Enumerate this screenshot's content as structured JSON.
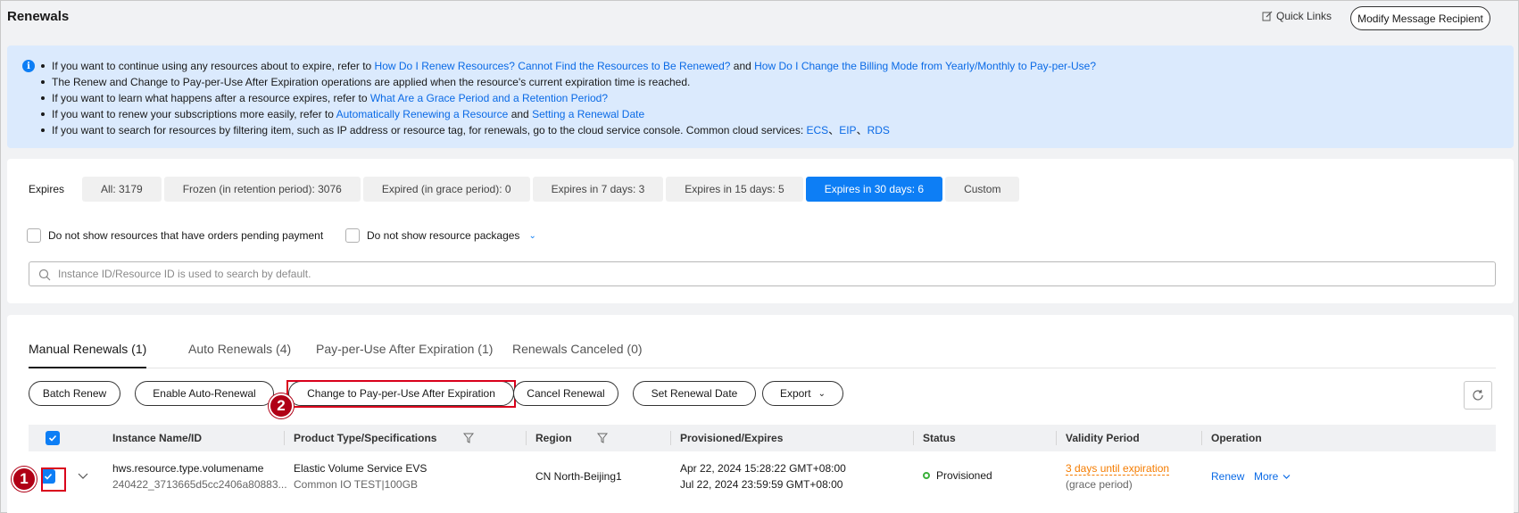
{
  "header": {
    "title": "Renewals",
    "quick_links": "Quick Links",
    "modify_button": "Modify Message Recipient"
  },
  "notice": {
    "line1_pre": "If you want to continue using any resources about to expire, refer to ",
    "line1_link1": "How Do I Renew Resources? Cannot Find the Resources to Be Renewed?",
    "line1_mid": " and ",
    "line1_link2": "How Do I Change the Billing Mode from Yearly/Monthly to Pay-per-Use?",
    "line2": "The Renew and Change to Pay-per-Use After Expiration operations are applied when the resource's current expiration time is reached.",
    "line3_pre": "If you want to learn what happens after a resource expires, refer to ",
    "line3_link": "What Are a Grace Period and a Retention Period?",
    "line4_pre": "If you want to renew your subscriptions more easily, refer to ",
    "line4_link1": "Automatically Renewing a Resource",
    "line4_mid": " and ",
    "line4_link2": "Setting a Renewal Date",
    "line5_pre": "If you want to search for resources by filtering item, such as IP address or resource tag, for renewals, go to the cloud service console. Common cloud services: ",
    "line5_links": [
      "ECS",
      "EIP",
      "RDS"
    ],
    "line5_sep": "、"
  },
  "filters": {
    "expires_label": "Expires",
    "tabs": [
      {
        "label": "All: 3179"
      },
      {
        "label": "Frozen (in retention period): 3076"
      },
      {
        "label": "Expired (in grace period): 0"
      },
      {
        "label": "Expires in 7 days: 3"
      },
      {
        "label": "Expires in 15 days: 5"
      },
      {
        "label": "Expires in 30 days: 6"
      },
      {
        "label": "Custom"
      }
    ],
    "active_tab": "Expires in 30 days: 6",
    "checkbox1": "Do not show resources that have orders pending payment",
    "checkbox2": "Do not show resource packages",
    "search_placeholder": "Instance ID/Resource ID is used to search by default."
  },
  "renewal_tabs": [
    {
      "label": "Manual Renewals (1)"
    },
    {
      "label": "Auto Renewals (4)"
    },
    {
      "label": "Pay-per-Use After Expiration (1)"
    },
    {
      "label": "Renewals Canceled (0)"
    }
  ],
  "actions": {
    "batch_renew": "Batch Renew",
    "enable_auto": "Enable Auto-Renewal",
    "change_ppu": "Change to Pay-per-Use After Expiration",
    "cancel_renewal": "Cancel Renewal",
    "set_date": "Set Renewal Date",
    "export": "Export"
  },
  "markers": {
    "one": "1",
    "two": "2"
  },
  "table": {
    "columns": [
      "Instance Name/ID",
      "Product Type/Specifications",
      "Region",
      "Provisioned/Expires",
      "Status",
      "Validity Period",
      "Operation"
    ],
    "row": {
      "name": "hws.resource.type.volumename",
      "id": "240422_3713665d5cc2406a80883...",
      "product": "Elastic Volume Service EVS",
      "spec": "Common IO TEST|100GB",
      "region": "CN North-Beijing1",
      "provisioned": "Apr 22, 2024 15:28:22 GMT+08:00",
      "expires": "Jul 22, 2024 23:59:59 GMT+08:00",
      "status": "Provisioned",
      "validity": "3 days until expiration",
      "validity_sub": "(grace period)",
      "op_renew": "Renew",
      "op_more": "More"
    }
  },
  "colors": {
    "accent": "#0d7ef5",
    "highlight": "#d9001b",
    "warning": "#f57c00",
    "status_ok": "#3ab03a"
  }
}
